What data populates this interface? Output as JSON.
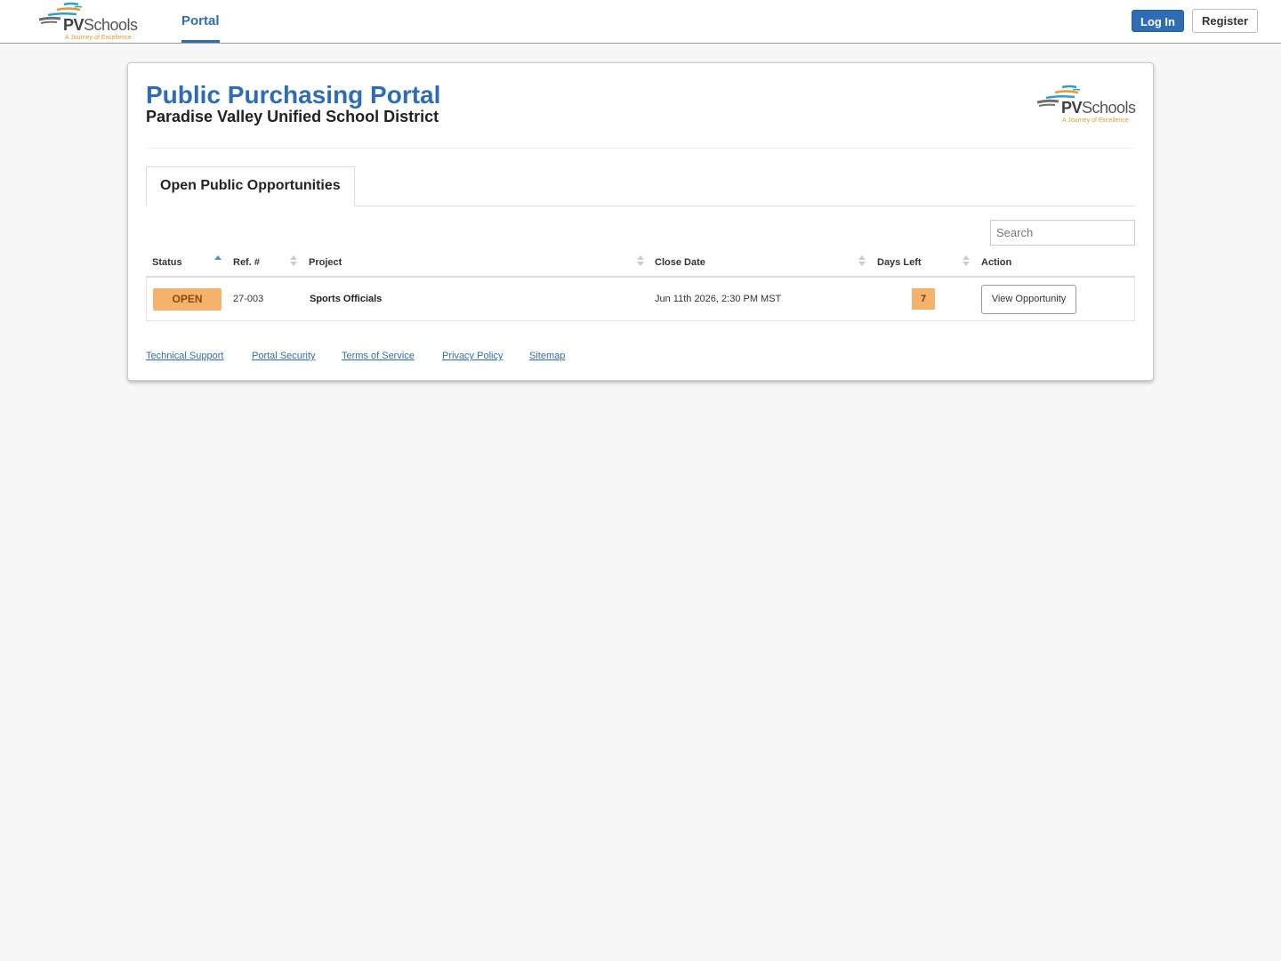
{
  "brand": {
    "logo_word_bold": "PV",
    "logo_word_rest": "Schools",
    "logo_tagline": "A Journey of Excellence",
    "logo_colors": [
      "#2ba3c5",
      "#e39a2e",
      "#6f6f6f"
    ]
  },
  "nav": {
    "tab_label": "Portal",
    "login_label": "Log In",
    "register_label": "Register"
  },
  "header": {
    "title": "Public Purchasing Portal",
    "subtitle": "Paradise Valley Unified School District"
  },
  "tabs": {
    "active_label": "Open Public Opportunities"
  },
  "search": {
    "placeholder": "Search",
    "value": ""
  },
  "table": {
    "columns": [
      "Status",
      "Ref. #",
      "Project",
      "Close Date",
      "Days Left",
      "Action"
    ],
    "sorted_column": "Status",
    "sort_direction": "ascending",
    "rows": [
      {
        "status": "OPEN",
        "ref": "27-003",
        "project": "Sports Officials",
        "close_date": "Jun 11th 2026, 2:30 PM MST",
        "days_left": "7",
        "action": "View Opportunity"
      }
    ]
  },
  "footer": {
    "links": [
      "Technical Support",
      "Portal Security",
      "Terms of Service",
      "Privacy Policy",
      "Sitemap"
    ]
  },
  "colors": {
    "accent": "#2e6db4",
    "status_badge": "#f5b26a",
    "background": "#f7f7f7"
  }
}
